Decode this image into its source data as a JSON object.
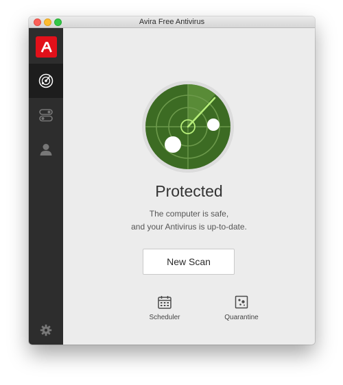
{
  "window": {
    "title": "Avira Free Antivirus"
  },
  "sidebar": {
    "items": [
      {
        "icon": "radar-icon",
        "active": true
      },
      {
        "icon": "toggles-icon",
        "active": false
      },
      {
        "icon": "user-icon",
        "active": false
      }
    ],
    "settings_icon": "gear-icon"
  },
  "main": {
    "status_title": "Protected",
    "status_line1": "The computer is safe,",
    "status_line2": "and your Antivirus is up-to-date.",
    "scan_button": "New Scan",
    "tools": [
      {
        "label": "Scheduler",
        "icon": "calendar-icon"
      },
      {
        "label": "Quarantine",
        "icon": "quarantine-icon"
      }
    ]
  },
  "colors": {
    "brand": "#e2101a",
    "sidebar": "#2d2d2d",
    "radar_green": "#3c6b23",
    "radar_sweep": "#b7ee7a"
  }
}
